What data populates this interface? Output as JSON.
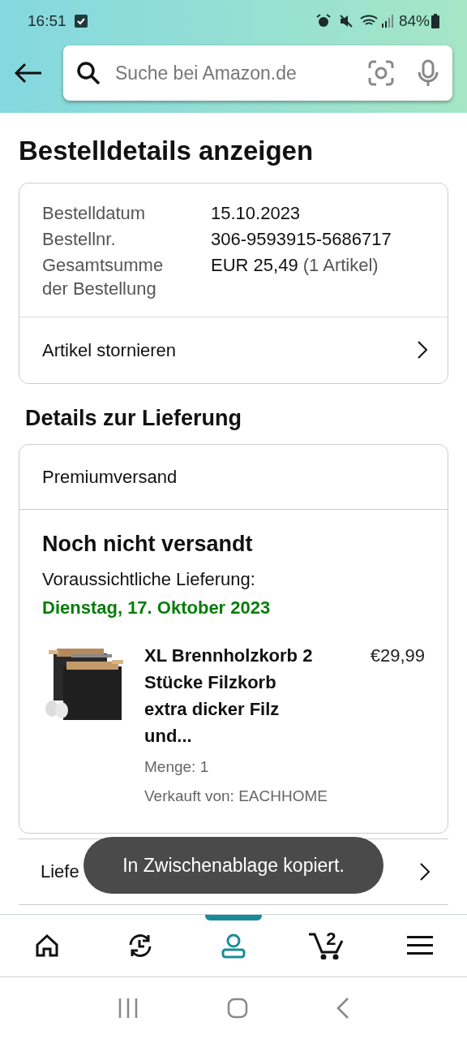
{
  "status_bar": {
    "time": "16:51",
    "battery": "84%"
  },
  "search": {
    "placeholder": "Suche bei Amazon.de"
  },
  "page_title": "Bestelldetails anzeigen",
  "order_info": {
    "rows": [
      {
        "label": "Bestelldatum",
        "value": "15.10.2023"
      },
      {
        "label": "Bestellnr.",
        "value": "306-9593915-5686717"
      },
      {
        "label": "Gesamtsumme der Bestellung",
        "value": "EUR 25,49",
        "note": "(1 Artikel)"
      }
    ],
    "action": "Artikel stornieren"
  },
  "delivery_heading": "Details zur Lieferung",
  "shipment": {
    "method": "Premiumversand",
    "status": "Noch nicht versandt",
    "eta_label": "Voraussichtliche Lieferung:",
    "eta_date": "Dienstag, 17. Oktober 2023",
    "item": {
      "title": "XL Brennholzkorb 2 Stücke Filzkorb extra dicker Filz und...",
      "price": "€29,99",
      "quantity": "Menge: 1",
      "seller": "Verkauft von: EACHHOME"
    }
  },
  "track_row": "Liefe",
  "toast": "In Zwischenablage kopiert.",
  "bottom_nav": [
    {
      "kind": "home",
      "selected": false
    },
    {
      "kind": "history",
      "selected": false
    },
    {
      "kind": "account",
      "selected": true
    },
    {
      "kind": "cart",
      "selected": false,
      "count": "2"
    },
    {
      "kind": "menu",
      "selected": false
    }
  ]
}
